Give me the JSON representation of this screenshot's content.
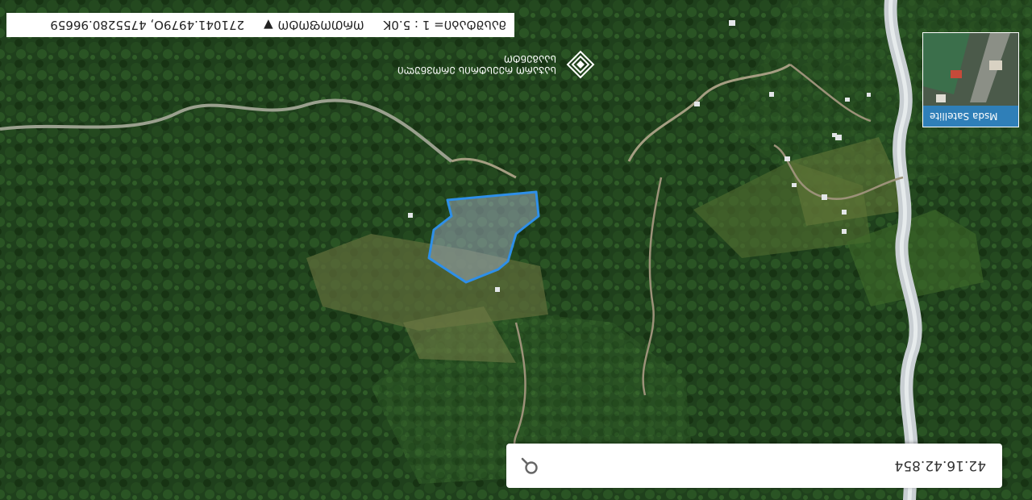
{
  "search": {
    "value": "42.16.42.854",
    "placeholder": ""
  },
  "status_bar": {
    "scale_text": "ᲛᲐᲡᲨᲢᲐᲑᲘ= 1 : 5.0K",
    "scale_select_label": "ᲝᲠᲗᲝᲤᲝᲢᲝ",
    "coordinates": "271041.4979O, 4755280.96659"
  },
  "logo": {
    "line1": "ᲡᲐᲯᲐᲠᲝ ᲠᲔᲔᲡᲢᲠᲘᲡ ᲔᲠᲝᲕᲜᲣᲚᲘ",
    "line2": "ᲡᲐᲐᲒᲔᲜᲢᲝ"
  },
  "layer_switcher": {
    "label": "Msda Satellite"
  },
  "colors": {
    "parcel_outline": "#2e8fe8",
    "parcel_fill": "#9aa8b8",
    "forest": "#1d3d1a",
    "river": "#c7cdd1"
  },
  "icons": {
    "search": "search-icon",
    "chevron": "chevron-down-icon",
    "logo": "diamond-logo-icon"
  }
}
